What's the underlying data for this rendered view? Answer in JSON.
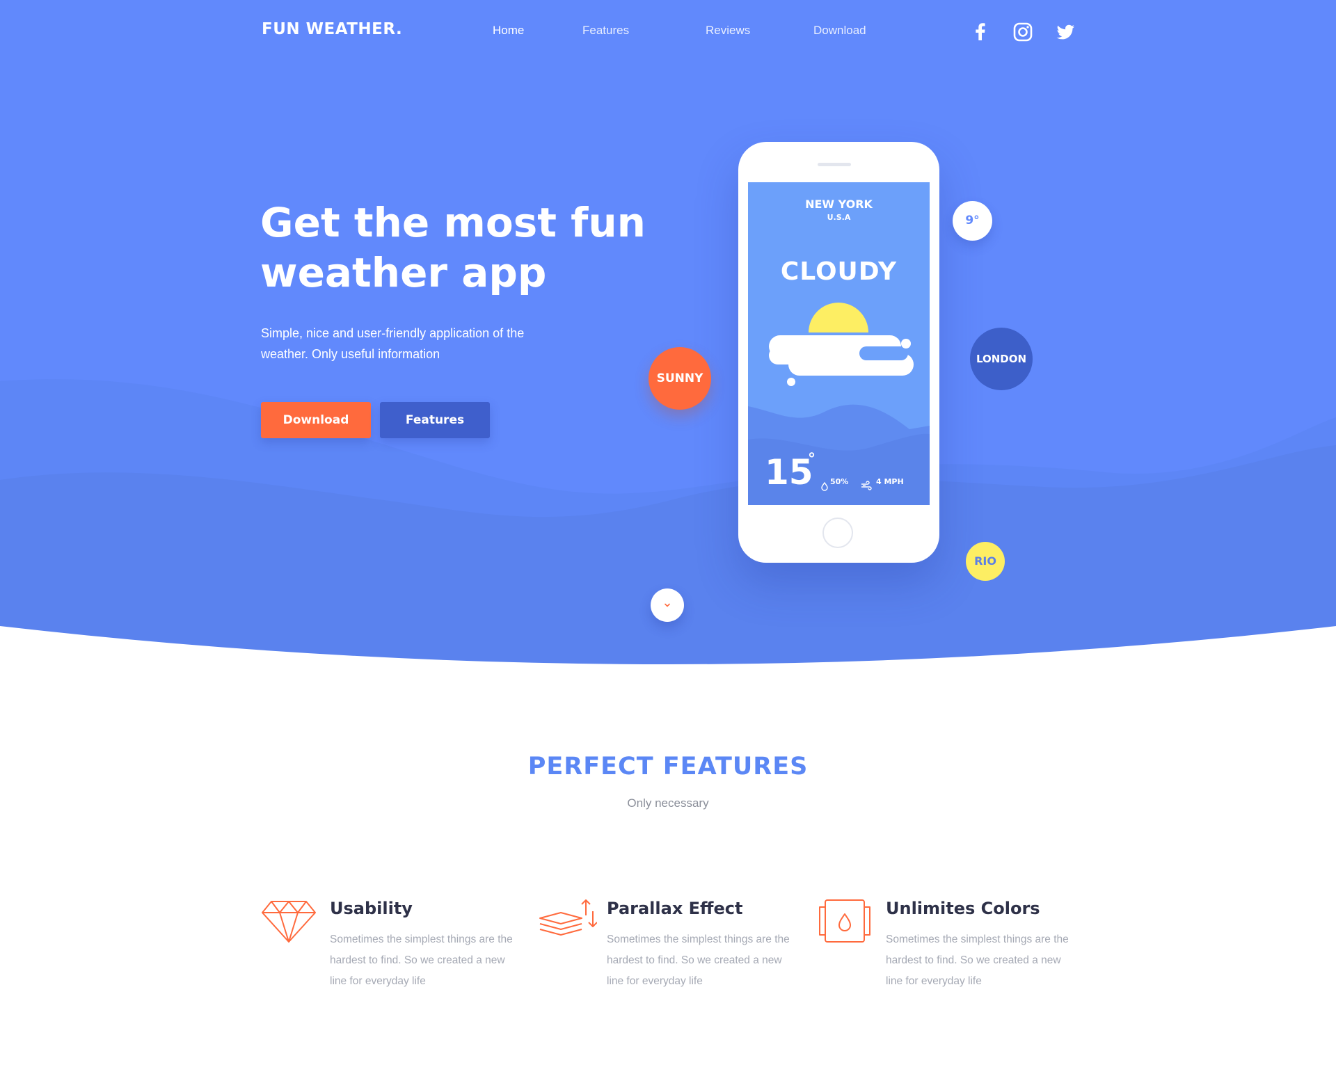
{
  "nav": {
    "logo": "FUN WEATHER.",
    "links": [
      "Home",
      "Features",
      "Reviews",
      "Download"
    ],
    "active": "Home",
    "social": [
      "facebook-icon",
      "instagram-icon",
      "twitter-icon"
    ]
  },
  "hero": {
    "title": "Get the most fun weather app",
    "subtitle": "Simple, nice and user-friendly application of the weather. Only useful information",
    "download_label": "Download",
    "features_label": "Features"
  },
  "phone": {
    "city": "NEW YORK",
    "country": "U.S.A",
    "condition": "CLOUDY",
    "temperature": "15",
    "degree": "°",
    "humidity": "50%",
    "wind": "4 MPH"
  },
  "bubbles": {
    "sunny": "SUNNY",
    "london": "LONDON",
    "rio": "RIO",
    "nine": "9°"
  },
  "scroll_icon": "chevron-down-icon",
  "features_section": {
    "title": "PERFECT FEATURES",
    "subtitle": "Only necessary",
    "items": [
      {
        "icon": "diamond-icon",
        "title": "Usability",
        "desc": "Sometimes the simplest things are the hardest to find. So we created a new line for everyday life"
      },
      {
        "icon": "layers-icon",
        "title": "Parallax Effect",
        "desc": "Sometimes the simplest things are the hardest to find. So we created a new line for everyday life"
      },
      {
        "icon": "color-drop-icon",
        "title": "Unlimites Colors",
        "desc": "Sometimes the simplest things are the hardest to find. So we created a new line for everyday life"
      }
    ]
  },
  "colors": {
    "hero_bg": "#6189fc",
    "accent_orange": "#ff6a3d",
    "accent_blue": "#3f5fcc",
    "accent_yellow": "#fdee63",
    "title_blue": "#5b87f5"
  }
}
